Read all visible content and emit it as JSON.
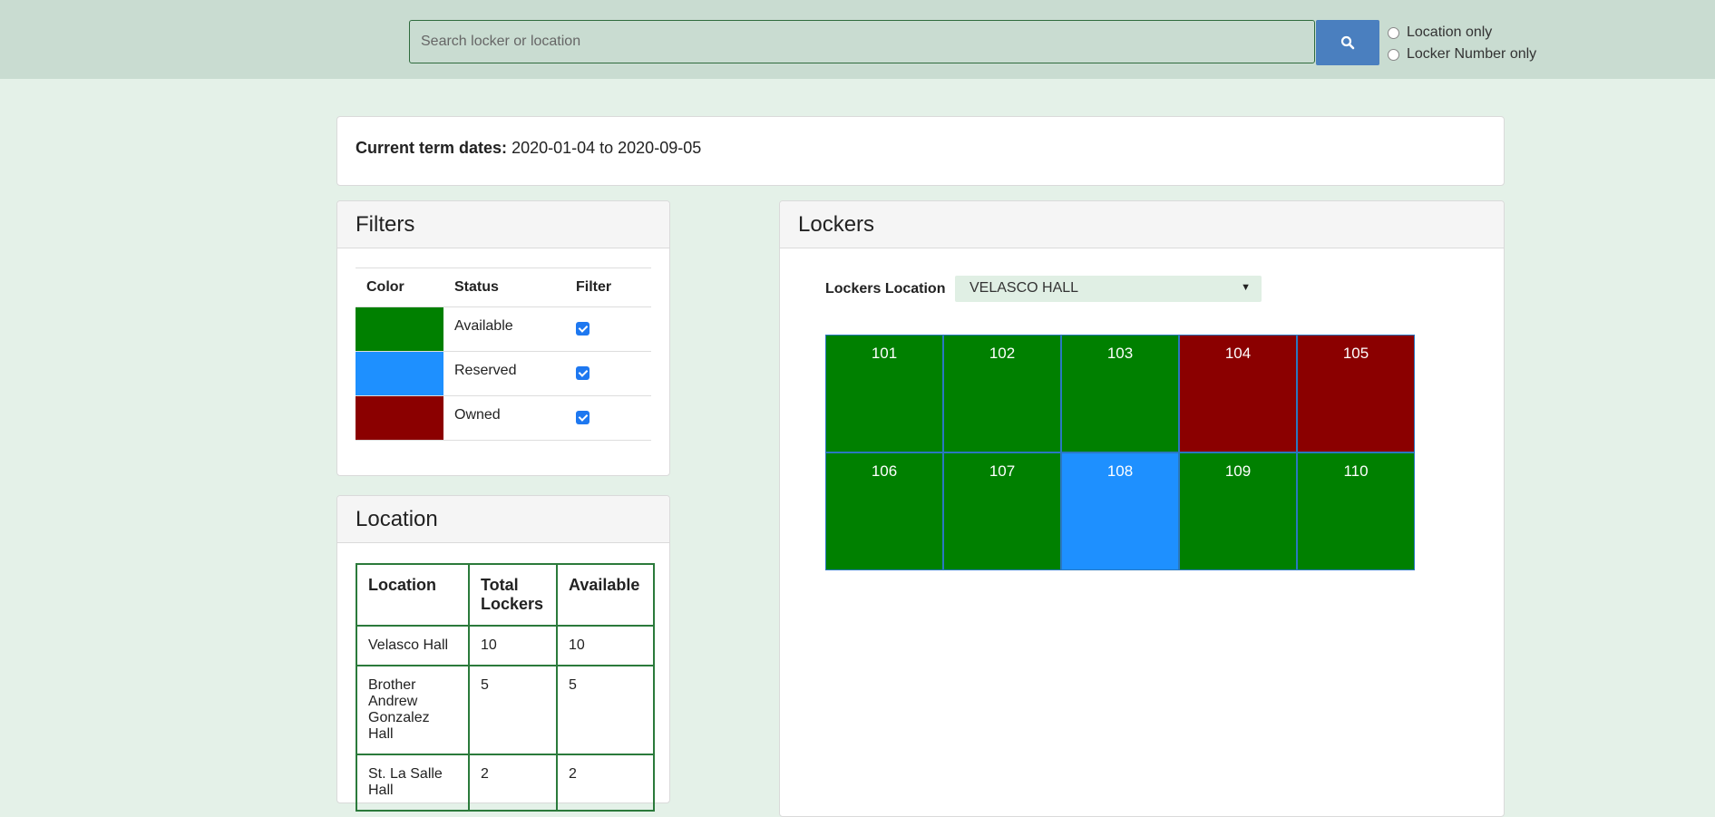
{
  "search": {
    "placeholder": "Search locker or location",
    "options": [
      "Location only",
      "Locker Number only"
    ]
  },
  "term": {
    "label": "Current term dates:",
    "value": "2020-01-04 to 2020-09-05"
  },
  "filters": {
    "title": "Filters",
    "headers": [
      "Color",
      "Status",
      "Filter"
    ],
    "rows": [
      {
        "color": "#008000",
        "status": "Available",
        "checked": true
      },
      {
        "color": "#1e90ff",
        "status": "Reserved",
        "checked": true
      },
      {
        "color": "#8b0000",
        "status": "Owned",
        "checked": true
      }
    ]
  },
  "location": {
    "title": "Location",
    "headers": [
      "Location",
      "Total Lockers",
      "Available"
    ],
    "rows": [
      [
        "Velasco Hall",
        "10",
        "10"
      ],
      [
        "Brother Andrew Gonzalez Hall",
        "5",
        "5"
      ],
      [
        "St. La Salle Hall",
        "2",
        "2"
      ]
    ]
  },
  "lockers": {
    "title": "Lockers",
    "location_label": "Lockers Location",
    "location_value": "VELASCO HALL",
    "items": [
      {
        "number": "101",
        "color": "#008000"
      },
      {
        "number": "102",
        "color": "#008000"
      },
      {
        "number": "103",
        "color": "#008000"
      },
      {
        "number": "104",
        "color": "#8b0000"
      },
      {
        "number": "105",
        "color": "#8b0000"
      },
      {
        "number": "106",
        "color": "#008000"
      },
      {
        "number": "107",
        "color": "#008000"
      },
      {
        "number": "108",
        "color": "#1e90ff"
      },
      {
        "number": "109",
        "color": "#008000"
      },
      {
        "number": "110",
        "color": "#008000"
      }
    ]
  }
}
